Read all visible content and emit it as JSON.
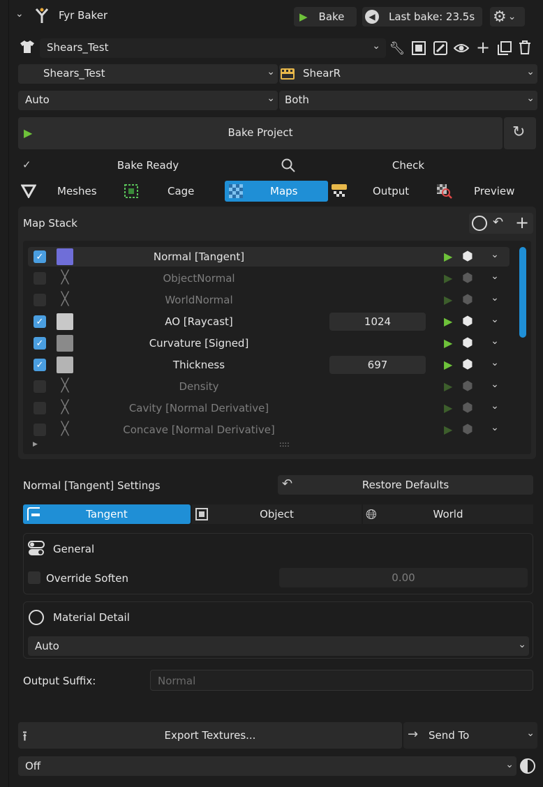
{
  "header": {
    "title": "Fyr Baker",
    "bake_label": "Bake",
    "last_bake": "Last bake: 23.5s"
  },
  "project_row": {
    "name": "Shears_Test"
  },
  "selectors": {
    "project": "Shears_Test",
    "target": "ShearR",
    "mode": "Auto",
    "side": "Both"
  },
  "bake_project_label": "Bake Project",
  "status": {
    "ready": "Bake Ready",
    "check": "Check"
  },
  "tabs": [
    {
      "label": "Meshes"
    },
    {
      "label": "Cage"
    },
    {
      "label": "Maps"
    },
    {
      "label": "Output"
    },
    {
      "label": "Preview"
    }
  ],
  "map_stack": {
    "title": "Map Stack",
    "items": [
      {
        "label": "Normal [Tangent]",
        "enabled": true,
        "value": ""
      },
      {
        "label": "ObjectNormal",
        "enabled": false,
        "value": ""
      },
      {
        "label": "WorldNormal",
        "enabled": false,
        "value": ""
      },
      {
        "label": "AO [Raycast]",
        "enabled": true,
        "value": "1024"
      },
      {
        "label": "Curvature [Signed]",
        "enabled": true,
        "value": ""
      },
      {
        "label": "Thickness",
        "enabled": true,
        "value": "697"
      },
      {
        "label": "Density",
        "enabled": false,
        "value": ""
      },
      {
        "label": "Cavity [Normal Derivative]",
        "enabled": false,
        "value": ""
      },
      {
        "label": "Concave [Normal Derivative]",
        "enabled": false,
        "value": ""
      }
    ],
    "handle": "::::"
  },
  "settings": {
    "title": "Normal [Tangent] Settings",
    "restore": "Restore Defaults",
    "space_tabs": [
      "Tangent",
      "Object",
      "World"
    ],
    "general_label": "General",
    "override_soften_label": "Override Soften",
    "override_soften_value": "0.00",
    "material_detail_label": "Material Detail",
    "material_detail_value": "Auto",
    "output_suffix_label": "Output Suffix:",
    "output_suffix_placeholder": "Normal"
  },
  "footer": {
    "export_label": "Export Textures...",
    "send_to_label": "Send To",
    "off_value": "Off"
  },
  "colors": {
    "accent": "#1f8fd6",
    "play_green": "#6ec23a",
    "checkbox": "#4a9ee0"
  }
}
